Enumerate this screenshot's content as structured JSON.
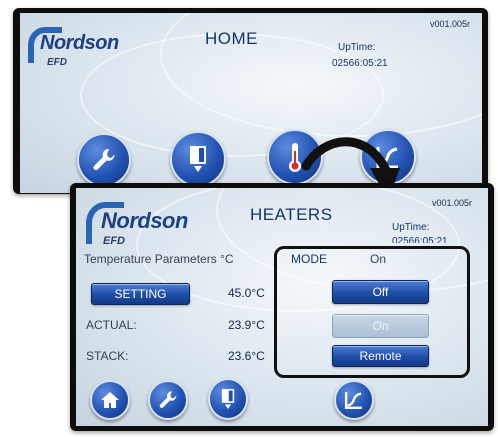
{
  "home": {
    "logo": "Nordson",
    "sublogo": "EFD",
    "title": "HOME",
    "version": "v001.005r",
    "uptime_label": "UpTime:",
    "uptime_value": "02566:05:21",
    "buttons": [
      {
        "icon": "wrench-icon"
      },
      {
        "icon": "dispenser-icon"
      },
      {
        "icon": "thermometer-icon"
      },
      {
        "icon": "graph-icon"
      }
    ]
  },
  "heaters": {
    "logo": "Nordson",
    "sublogo": "EFD",
    "title": "HEATERS",
    "version": "v001.005r",
    "uptime_label": "UpTime:",
    "uptime_value": "02566:05:21",
    "temp_header": "Temperature Parameters °C",
    "setting_label": "SETTING",
    "setting_value": "45.0°C",
    "actual_label": "ACTUAL:",
    "actual_value": "23.9°C",
    "stack_label": "STACK:",
    "stack_value": "23.6°C",
    "mode_label": "MODE",
    "mode_value": "On",
    "mode_options": {
      "off": "Off",
      "on": "On",
      "remote": "Remote"
    },
    "buttons": [
      {
        "icon": "home-icon"
      },
      {
        "icon": "wrench-icon"
      },
      {
        "icon": "dispenser-icon"
      },
      {
        "icon": "graph-icon"
      }
    ]
  },
  "colors": {
    "accent": "#1e4ca6",
    "brand": "#1c3f86",
    "warning_text": "#c8141e",
    "frame": "#0d0d0d"
  }
}
